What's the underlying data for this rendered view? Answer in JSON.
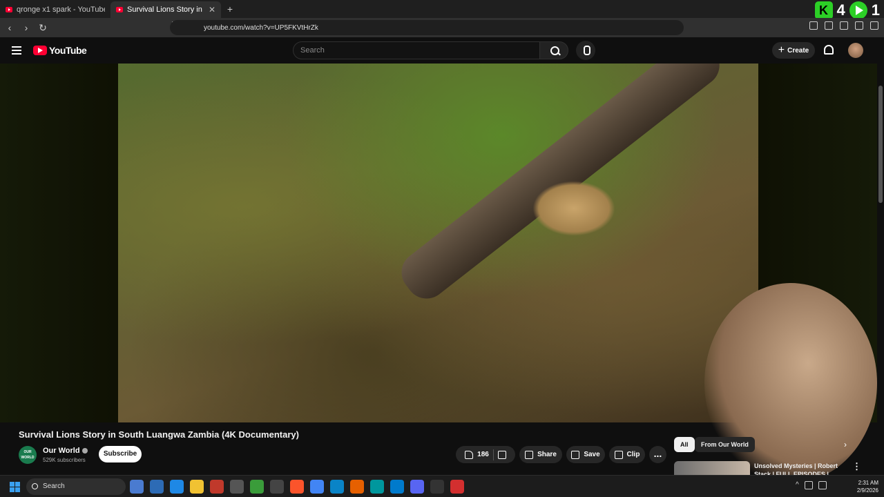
{
  "browser": {
    "tabs": [
      {
        "title": "qronge x1 spark - YouTube",
        "active": false
      },
      {
        "title": "Survival Lions Story in South L",
        "active": true
      }
    ],
    "newtab_label": "+",
    "url": "youtube.com/watch?v=UP5FKVtHrZk",
    "overlay_counter_1": "4",
    "overlay_counter_2": "1"
  },
  "header": {
    "logo_text": "YouTube",
    "search_placeholder": "Search",
    "create_label": "Create"
  },
  "video": {
    "title": "Survival Lions Story in South Luangwa Zambia (4K Documentary)",
    "channel": {
      "name": "Our World",
      "avatar_text": "OUR WORLD",
      "subscribers": "529K subscribers"
    },
    "subscribe_label": "Subscribe",
    "likes": "186",
    "share_label": "Share",
    "save_label": "Save",
    "clip_label": "Clip",
    "more_label": "..."
  },
  "sidebar": {
    "chips": [
      {
        "label": "All",
        "active": true
      },
      {
        "label": "From Our World",
        "active": false
      }
    ],
    "recommendations": [
      {
        "title": "Unsolved Mysteries | Robert Stack | FULL EPISODES |"
      }
    ]
  },
  "taskbar": {
    "search_label": "Search",
    "time": "2:31 AM",
    "date": "2/9/2026"
  },
  "colors": {
    "accent": "#ff0033",
    "background": "#0f0f0f",
    "pill": "#272727"
  }
}
